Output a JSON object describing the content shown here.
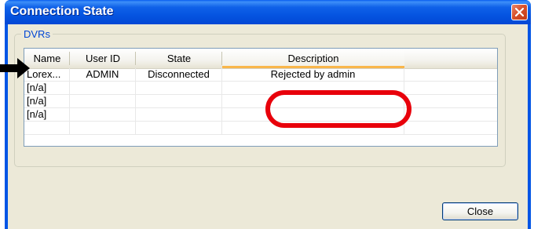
{
  "window": {
    "title": "Connection State"
  },
  "group": {
    "label": "DVRs"
  },
  "list": {
    "columns": [
      "Name",
      "User ID",
      "State",
      "Description",
      ""
    ],
    "rows": [
      [
        "Lorex...",
        "ADMIN",
        "Disconnected",
        "Rejected by admin",
        ""
      ],
      [
        "[n/a]",
        "",
        "",
        "",
        ""
      ],
      [
        "[n/a]",
        "",
        "",
        "",
        ""
      ],
      [
        "[n/a]",
        "",
        "",
        "",
        ""
      ],
      [
        "",
        "",
        "",
        "",
        ""
      ]
    ]
  },
  "buttons": {
    "close": "Close"
  },
  "annotations": {
    "highlight_color": "#e8000b",
    "arrow_color": "#000000"
  },
  "icons": {
    "close": "close-x-icon"
  }
}
